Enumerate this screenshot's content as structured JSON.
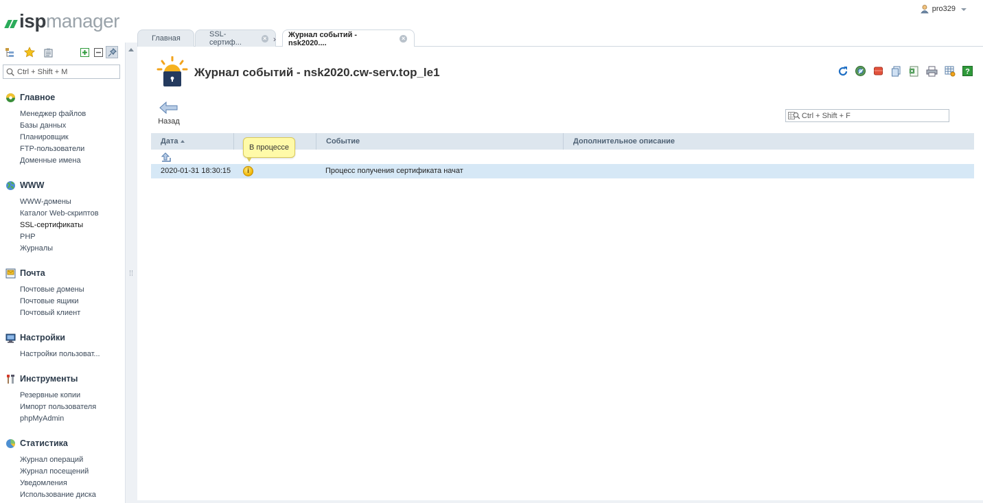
{
  "app": {
    "logo_bold": "isp",
    "logo_light": "manager",
    "user": "pro329"
  },
  "sidebar": {
    "search_placeholder": "Ctrl + Shift + M",
    "groups": [
      {
        "title": "Главное",
        "icon": "main-icon",
        "items": [
          "Менеджер файлов",
          "Базы данных",
          "Планировщик",
          "FTP-пользователи",
          "Доменные имена"
        ]
      },
      {
        "title": "WWW",
        "icon": "globe-icon",
        "items": [
          "WWW-домены",
          "Каталог Web-скриптов",
          "SSL-сертификаты",
          "PHP",
          "Журналы"
        ]
      },
      {
        "title": "Почта",
        "icon": "mail-icon",
        "items": [
          "Почтовые домены",
          "Почтовые ящики",
          "Почтовый клиент"
        ]
      },
      {
        "title": "Настройки",
        "icon": "settings-monitor-icon",
        "items": [
          "Настройки пользоват..."
        ]
      },
      {
        "title": "Инструменты",
        "icon": "tools-icon",
        "items": [
          "Резервные копии",
          "Импорт пользователя",
          "phpMyAdmin"
        ]
      },
      {
        "title": "Статистика",
        "icon": "stats-pie-icon",
        "items": [
          "Журнал операций",
          "Журнал посещений",
          "Уведомления",
          "Использование диска"
        ]
      }
    ],
    "active_item": "SSL-сертификаты"
  },
  "tabs": [
    {
      "label": "Главная"
    },
    {
      "label": "SSL-сертиф..."
    },
    {
      "label": "Журнал событий - nsk2020...."
    }
  ],
  "page": {
    "title": "Журнал событий - nsk2020.cw-serv.top_le1",
    "back_label": "Назад",
    "filter_placeholder": "Ctrl + Shift + F"
  },
  "table": {
    "columns": [
      "Дата",
      "",
      "Событие",
      "Дополнительное описание"
    ],
    "rows": [
      {
        "date": "2020-01-31 18:30:15",
        "status": "info",
        "event": "Процесс получения сертификата начат",
        "description": ""
      }
    ]
  },
  "tooltip": "В процессе"
}
